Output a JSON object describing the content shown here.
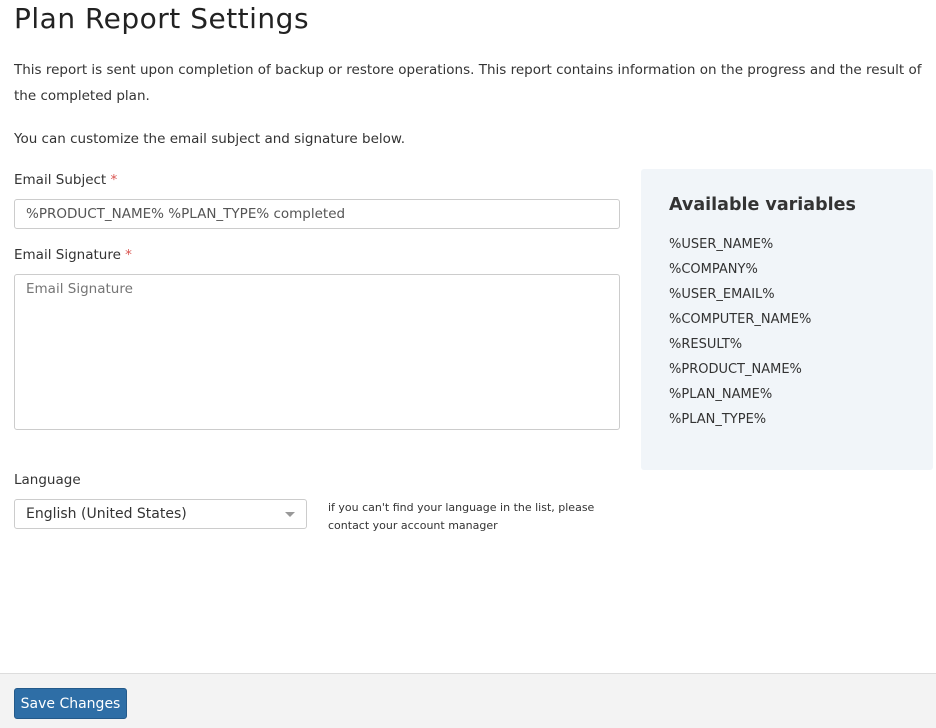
{
  "title": "Plan Report Settings",
  "description": "This report is sent upon completion of backup or restore operations. This report contains information on the progress and the result of the completed plan.",
  "customize_note": "You can customize the email subject and signature below.",
  "email_subject": {
    "label": "Email Subject",
    "required": "*",
    "value": "%PRODUCT_NAME% %PLAN_TYPE% completed"
  },
  "email_signature": {
    "label": "Email Signature",
    "required": "*",
    "placeholder": "Email Signature",
    "value": ""
  },
  "language": {
    "label": "Language",
    "selected": "English (United States)",
    "hint": "if you can't find your language in the list, please contact your account manager"
  },
  "variables": {
    "title": "Available variables",
    "items": [
      "%USER_NAME%",
      "%COMPANY%",
      "%USER_EMAIL%",
      "%COMPUTER_NAME%",
      "%RESULT%",
      "%PRODUCT_NAME%",
      "%PLAN_NAME%",
      "%PLAN_TYPE%"
    ]
  },
  "footer": {
    "save_label": "Save Changes"
  },
  "colors": {
    "primary_button": "#2e6ea6",
    "required": "#d9534f",
    "variables_bg": "#f1f5f9"
  }
}
